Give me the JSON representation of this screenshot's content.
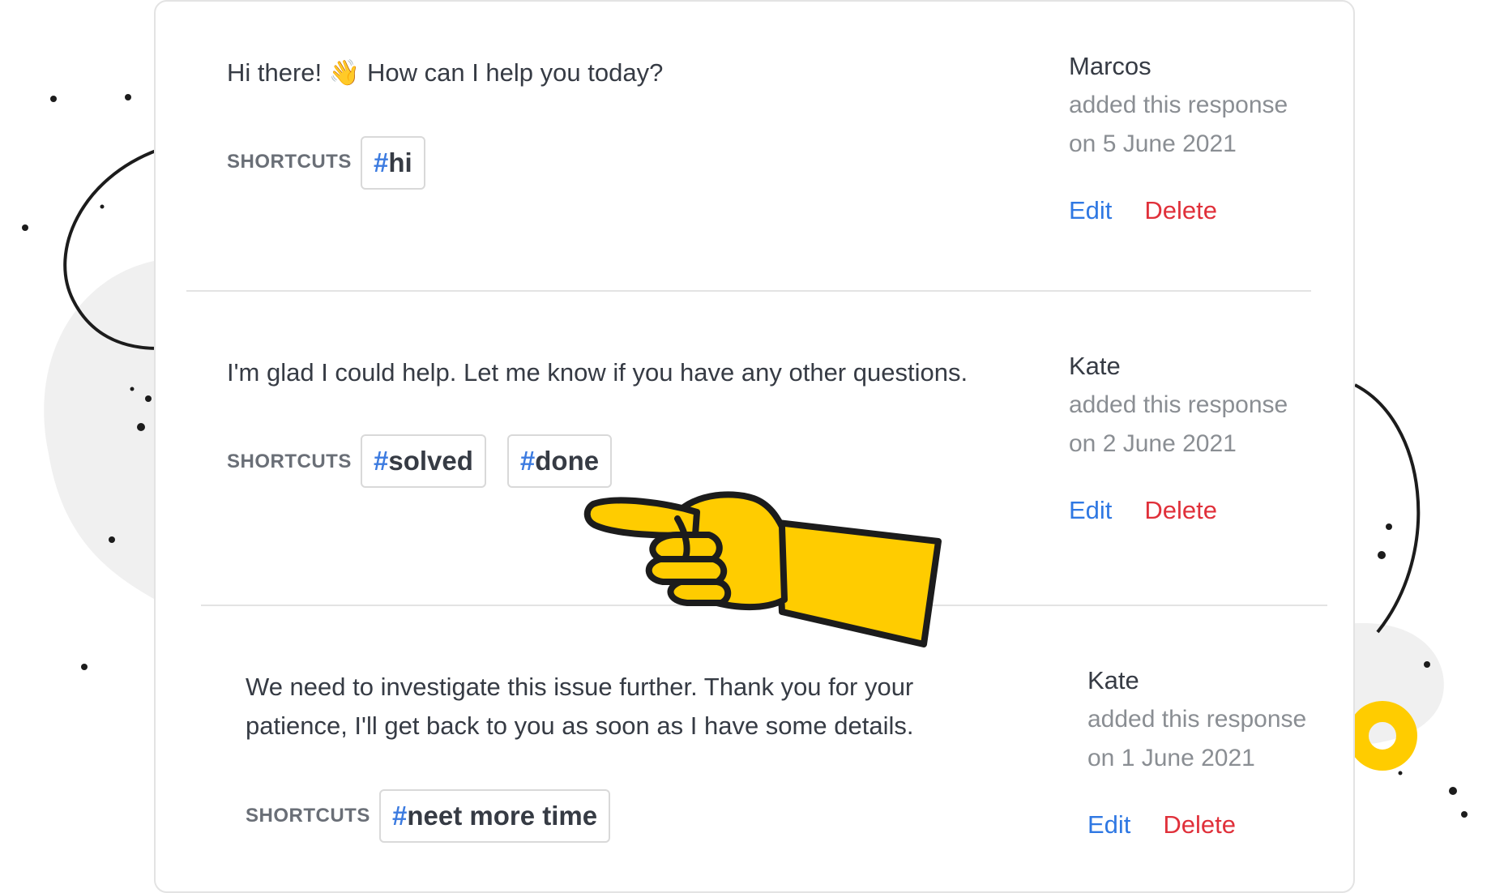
{
  "colors": {
    "accent_blue": "#2f78e3",
    "delete_red": "#e0303a",
    "hash_blue": "#3c7be0",
    "hand_yellow": "#ffcc00",
    "blob_gray": "#f0f0f0"
  },
  "responses": [
    {
      "message": "Hi there! 👋 How can I help you today?",
      "shortcuts_label": "SHORTCUTS",
      "shortcuts": [
        {
          "hash": "#",
          "text": "hi"
        }
      ],
      "author": "Marcos",
      "added_text": "added this response",
      "date_text": "on 5 June 2021",
      "edit_label": "Edit",
      "delete_label": "Delete"
    },
    {
      "message": "I'm glad I could help. Let me know if you have any other questions.",
      "shortcuts_label": "SHORTCUTS",
      "shortcuts": [
        {
          "hash": "#",
          "text": "solved"
        },
        {
          "hash": "#",
          "text": "done"
        }
      ],
      "author": "Kate",
      "added_text": "added this response",
      "date_text": "on 2 June 2021",
      "edit_label": "Edit",
      "delete_label": "Delete"
    },
    {
      "message_line1": "We need to investigate this issue further. Thank you for your",
      "message_line2": "patience, I'll get back to you as soon as I have some details.",
      "shortcuts_label": "SHORTCUTS",
      "shortcuts": [
        {
          "hash": "#",
          "text": "neet more time"
        }
      ],
      "author": "Kate",
      "added_text": "added this response",
      "date_text": "on 1 June 2021",
      "edit_label": "Edit",
      "delete_label": "Delete"
    }
  ]
}
